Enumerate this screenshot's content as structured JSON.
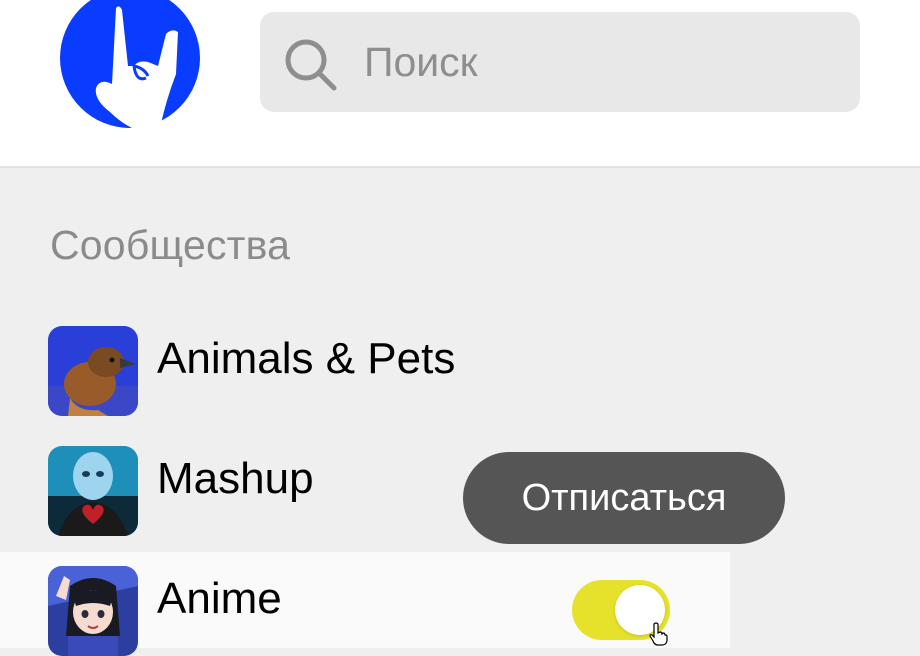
{
  "header": {
    "logo_icon": "rock-hand-logo",
    "brand_color": "#0a3cff",
    "search": {
      "placeholder": "Поиск",
      "value": "",
      "icon": "search-icon"
    }
  },
  "communities": {
    "title": "Сообщества",
    "items": [
      {
        "name": "Animals & Pets",
        "avatar": "bird-avatar"
      },
      {
        "name": "Mashup",
        "avatar": "mashup-avatar"
      },
      {
        "name": "Anime",
        "avatar": "anime-avatar",
        "toggle_on": true
      }
    ]
  },
  "tooltip": {
    "label": "Отписаться"
  },
  "colors": {
    "toggle_on": "#e6e12a",
    "tooltip_bg": "#555555",
    "section_title": "#8b8b8b"
  }
}
